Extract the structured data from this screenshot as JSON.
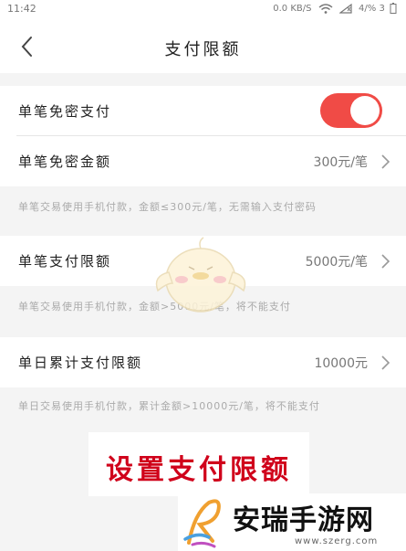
{
  "status_bar": {
    "time": "11:42",
    "network_text": "0.0 KB/S",
    "battery_text": "4/% 3"
  },
  "nav": {
    "title": "支付限额"
  },
  "settings": {
    "free_password_payment": {
      "label": "单笔免密支付",
      "enabled": true
    },
    "free_password_amount": {
      "label": "单笔免密金额",
      "value": "300元/笔"
    },
    "free_password_note": "单笔交易使用手机付款，金额≤300元/笔，无需输入支付密码",
    "single_payment_limit": {
      "label": "单笔支付限额",
      "value": "5000元/笔"
    },
    "single_payment_note": "单笔交易使用手机付款，金额>5000元/笔，将不能支付",
    "daily_payment_limit": {
      "label": "单日累计支付限额",
      "value": "10000元"
    },
    "daily_payment_note": "单日交易使用手机付款，累计金额>10000元/笔，将不能支付"
  },
  "overlay": {
    "caption": "设置支付限额"
  },
  "watermark": {
    "title": "安瑞手游网",
    "url": "www.szerg.com"
  },
  "colors": {
    "toggle_on": "#f04b46",
    "caption_red": "#d0021b",
    "background": "#f4f4f4"
  },
  "icons": {
    "back": "chevron-left-icon",
    "row_arrow": "chevron-right-icon"
  }
}
